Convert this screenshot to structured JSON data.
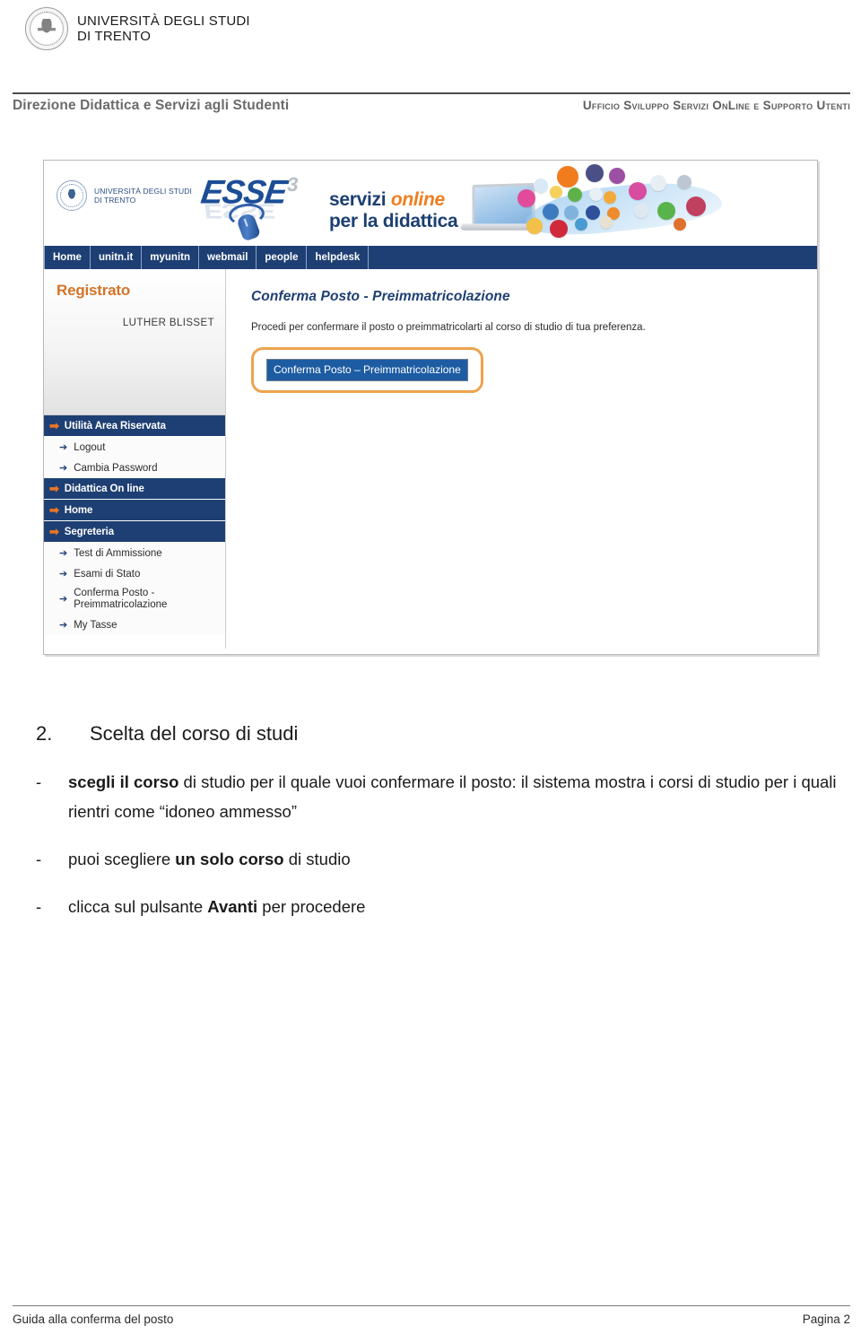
{
  "document": {
    "institution_line1": "UNIVERSITÀ DEGLI STUDI",
    "institution_line2": "DI TRENTO",
    "department_left": "Direzione Didattica e Servizi agli Studenti",
    "department_right": "Ufficio Sviluppo Servizi OnLine e Supporto Utenti"
  },
  "screenshot": {
    "banner": {
      "uni_line1": "UNIVERSITÀ DEGLI STUDI",
      "uni_line2": "DI TRENTO",
      "logo_word": "ESSE",
      "logo_sup": "3",
      "tagline_line1_a": "servizi ",
      "tagline_line1_b": "online",
      "tagline_line2": "per la didattica"
    },
    "nav": [
      {
        "label": "Home"
      },
      {
        "label": "unitn.it"
      },
      {
        "label": "myunitn"
      },
      {
        "label": "webmail"
      },
      {
        "label": "people"
      },
      {
        "label": "helpdesk"
      }
    ],
    "sidebar": {
      "role": "Registrato",
      "user_name": "LUTHER BLISSET",
      "menu": [
        {
          "type": "head",
          "label": "Utilità Area Riservata"
        },
        {
          "type": "sub",
          "label": "Logout"
        },
        {
          "type": "sub",
          "label": "Cambia Password"
        },
        {
          "type": "head",
          "label": "Didattica On line"
        },
        {
          "type": "head",
          "label": "Home"
        },
        {
          "type": "head",
          "label": "Segreteria"
        },
        {
          "type": "sub",
          "label": "Test di Ammissione"
        },
        {
          "type": "sub",
          "label": "Esami di Stato"
        },
        {
          "type": "sub",
          "label": "Conferma Posto - Preimmatricolazione",
          "two_line": true
        },
        {
          "type": "sub",
          "label": "My Tasse"
        }
      ]
    },
    "main": {
      "title": "Conferma Posto - Preimmatricolazione",
      "description": "Procedi per confermare il posto o preimmatricolarti al corso di studio di tua preferenza.",
      "cta_label": "Conferma Posto – Preimmatricolazione"
    },
    "colors": {
      "nav_blue": "#1e3f73",
      "accent_orange": "#ee7622",
      "role_orange": "#d4742a",
      "highlight_border": "#eda34d",
      "button_blue": "#1d5ca3"
    }
  },
  "section": {
    "number": "2.",
    "heading": "Scelta del corso di studi",
    "bullets": [
      {
        "dash": "-",
        "parts": [
          {
            "text": "scegli il corso",
            "bold": true
          },
          {
            "text": " di studio per il quale vuoi confermare il posto: il sistema mostra i corsi di studio per i quali rientri come “idoneo ammesso”",
            "bold": false
          }
        ]
      },
      {
        "dash": "-",
        "parts": [
          {
            "text": "puoi scegliere ",
            "bold": false
          },
          {
            "text": "un solo corso",
            "bold": true
          },
          {
            "text": " di studio",
            "bold": false
          }
        ]
      },
      {
        "dash": "-",
        "parts": [
          {
            "text": "clicca sul pulsante ",
            "bold": false
          },
          {
            "text": "Avanti",
            "bold": true
          },
          {
            "text": " per procedere",
            "bold": false
          }
        ]
      }
    ]
  },
  "footer": {
    "left": "Guida alla conferma del posto",
    "right": "Pagina 2"
  }
}
